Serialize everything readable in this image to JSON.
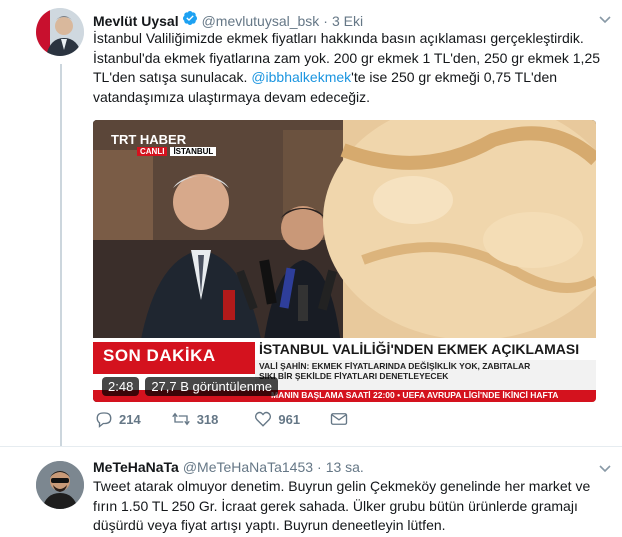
{
  "tweet": {
    "author_name": "Mevlüt Uysal",
    "author_handle": "@mevlutuysal_bsk",
    "dot": "·",
    "time": "3 Eki",
    "text_line1": "İstanbul Valiliğimizde ekmek fiyatları hakkında basın açıklaması gerçekleştirdik.",
    "text_line2": "İstanbul'da ekmek fiyatlarına zam yok. 200 gr ekmek 1 TL'den, 250 gr ekmek 1,25",
    "text_line3": "TL'den satışa sunulacak. ",
    "mention": "@ibbhalkekmek",
    "text_line3_rest": "'te ise 250 gr ekmeği 0,75 TL'den",
    "text_line4": "vatandaşımıza ulaştırmaya devam edeceğiz.",
    "video": {
      "channel": "TRT HABER",
      "live": "CANLI",
      "location": "İSTANBUL",
      "breaking": "SON DAKİKA",
      "headline": "İSTANBUL VALİLİĞİ'NDEN EKMEK AÇIKLAMASI",
      "subline1": "VALİ ŞAHİN: EKMEK FİYATLARINDA DEĞİŞİKLİK YOK, ZABITALAR",
      "subline2": "SIKI BİR ŞEKİLDE FİYATLARI DENETLEYECEK",
      "ticker": "MANIN BAŞLAMA SAATİ 22:00  •  UEFA AVRUPA LİGİ'NDE İKİNCİ HAFTA",
      "duration": "2:48",
      "views": "27,7 B görüntülenme"
    },
    "replies": "214",
    "retweets": "318",
    "likes": "961"
  },
  "reply": {
    "author_name": "MeTeHaNaTa",
    "author_handle": "@MeTeHaNaTa1453",
    "dot": "·",
    "time": "13 sa.",
    "text_line1": "Tweet atarak olmuyor denetim. Buyrun gelin Çekmeköy genelinde her market ve",
    "text_line2": "fırın 1.50 TL 250 Gr. İcraat gerek sahada. Ülker grubu bütün ürünlerde gramajı",
    "text_line3": "düşürdü veya fiyat artışı yaptı. Buyrun deneetleyin lütfen."
  },
  "colors": {
    "accent": "#1b95e0",
    "muted": "#657786",
    "breaking_red": "#d4121e"
  }
}
